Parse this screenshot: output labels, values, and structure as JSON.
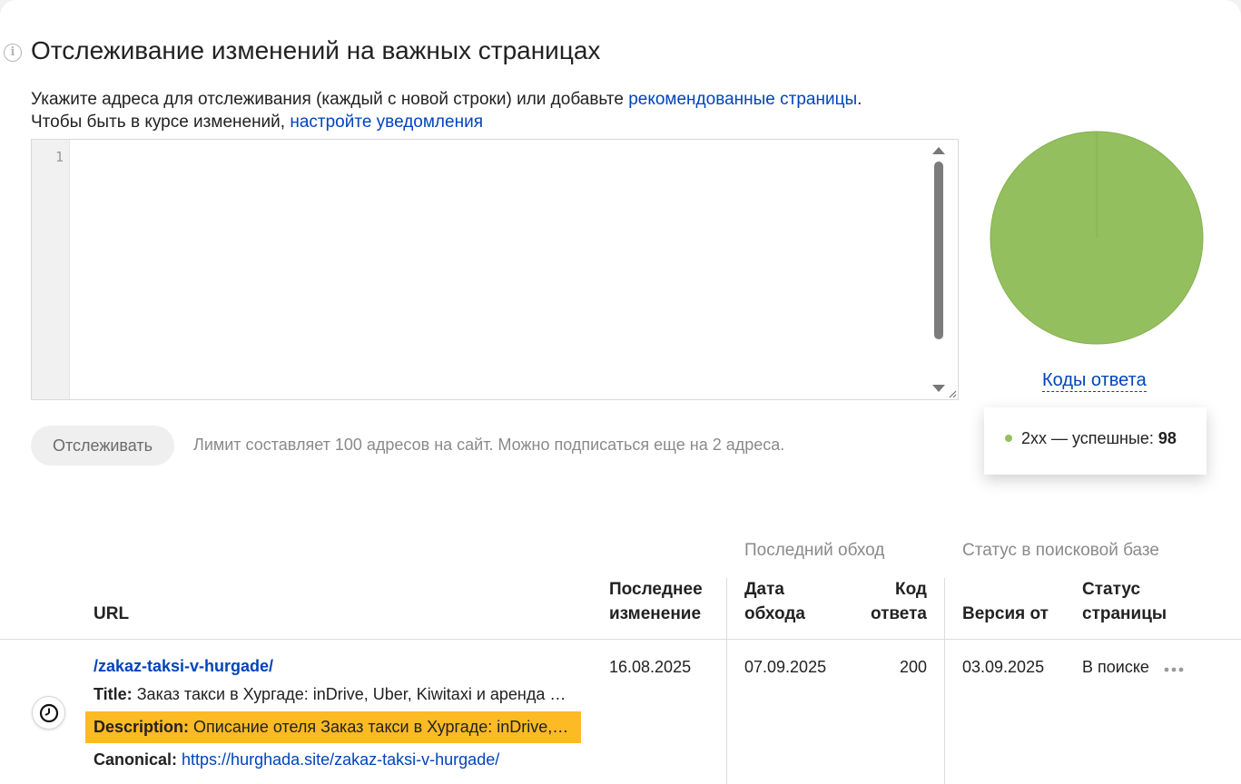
{
  "header": {
    "title": "Отслеживание изменений на важных страницах",
    "info_icon": "info-icon"
  },
  "hint": {
    "line1_text": "Укажите адреса для отслеживания (каждый с новой строки) или добавьте ",
    "line1_link": "рекомендованные страницы",
    "line1_end": ".",
    "line2_text": "Чтобы быть в курсе изменений, ",
    "line2_link": "настройте уведомления"
  },
  "editor": {
    "line_number": "1",
    "value": ""
  },
  "actions": {
    "track_button": "Отслеживать",
    "limit_text": "Лимит составляет 100 адресов на сайт. Можно подписаться еще на 2 адреса."
  },
  "chart_data": {
    "type": "pie",
    "title": "",
    "slices": [
      {
        "label": "2xx — успешные",
        "value": 98,
        "color": "#94bf5f"
      }
    ]
  },
  "chart_link": "Коды ответа",
  "tooltip": {
    "label": "2xx — успешные: ",
    "value": "98"
  },
  "table": {
    "group_last_crawl": "Последний обход",
    "group_search_status": "Статус в поисковой базе",
    "columns": {
      "url": "URL",
      "last_change_1": "Последнее",
      "last_change_2": "изменение",
      "crawl_date_1": "Дата",
      "crawl_date_2": "обхода",
      "code_1": "Код",
      "code_2": "ответа",
      "version": "Версия от",
      "status_1": "Статус",
      "status_2": "страницы"
    },
    "rows": [
      {
        "url": "/zakaz-taksi-v-hurgade/",
        "title_label": "Title:",
        "title_value": "Заказ такси в Хургаде: inDrive, Uber, Kiwitaxi и аренда авто",
        "description_label": "Description:",
        "description_value": "Описание отеля Заказ такси в Хургаде: inDrive, Uber, Kiwitaxi",
        "canonical_label": "Canonical:",
        "canonical_value": "https://hurghada.site/zakaz-taksi-v-hurgade/",
        "last_change": "16.08.2025",
        "crawl_date": "07.09.2025",
        "code": "200",
        "version": "03.09.2025",
        "status": "В поиске"
      }
    ]
  },
  "colors": {
    "link": "#0044bb",
    "pie_green": "#94bf5f",
    "highlight": "#fcba24"
  }
}
